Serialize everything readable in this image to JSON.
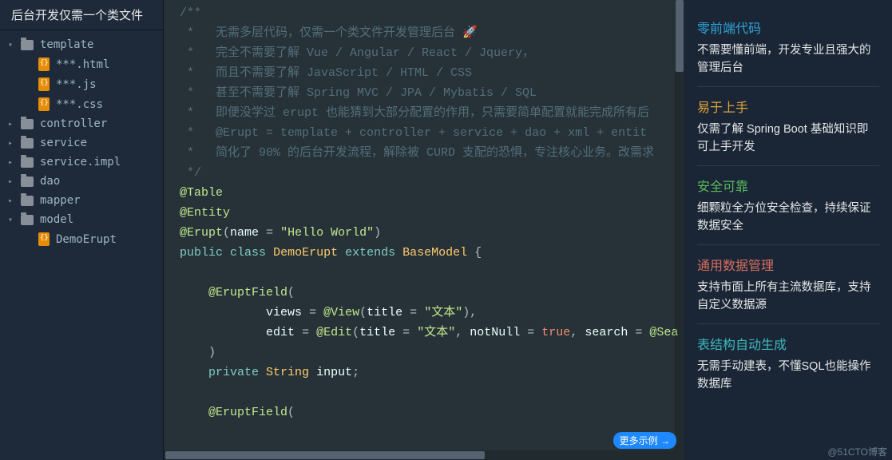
{
  "sidebar": {
    "title": "后台开发仅需一个类文件",
    "items": [
      {
        "label": "template",
        "type": "folder",
        "expand": "down"
      },
      {
        "label": "***.html",
        "type": "file"
      },
      {
        "label": "***.js",
        "type": "file"
      },
      {
        "label": "***.css",
        "type": "file"
      },
      {
        "label": "controller",
        "type": "folder",
        "expand": "right"
      },
      {
        "label": "service",
        "type": "folder",
        "expand": "right"
      },
      {
        "label": "service.impl",
        "type": "folder",
        "expand": "right"
      },
      {
        "label": "dao",
        "type": "folder",
        "expand": "right"
      },
      {
        "label": "mapper",
        "type": "folder",
        "expand": "right"
      },
      {
        "label": "model",
        "type": "folder",
        "expand": "down"
      },
      {
        "label": "DemoErupt",
        "type": "file"
      }
    ]
  },
  "code": {
    "c0": "/**",
    "c1": " *   无需多层代码，仅需一个类文件开发管理后台 🚀",
    "c2": " *   完全不需要了解 Vue / Angular / React / Jquery，",
    "c3": " *   而且不需要了解 JavaScript / HTML / CSS",
    "c4": " *   甚至不需要了解 Spring MVC / JPA / Mybatis / SQL",
    "c5": " *   即便没学过 erupt 也能猜到大部分配置的作用，只需要简单配置就能完成所有后",
    "c6": " *   @Erupt = template + controller + service + dao + xml + entit",
    "c7": " *   简化了 90% 的后台开发流程，解除被 CURD 支配的恐惧，专注核心业务。改需求",
    "c8": " */",
    "a_table": "@Table",
    "a_entity": "@Entity",
    "a_erupt": "@Erupt",
    "name_key": "name",
    "name_val": "\"Hello World\"",
    "kw_public": "public",
    "kw_class": "class",
    "cls_name": "DemoErupt",
    "kw_extends": "extends",
    "cls_base": "BaseModel",
    "a_field": "@EruptField",
    "views_key": "views",
    "a_view": "@View",
    "title_key": "title",
    "title_val": "\"文本\"",
    "edit_key": "edit",
    "a_edit": "@Edit",
    "notnull_key": "notNull",
    "true_val": "true",
    "search_key": "search",
    "a_sea": "@Sea",
    "kw_private": "private",
    "cls_string": "String",
    "fld_input": "input"
  },
  "editor": {
    "badge": "更多示例 →"
  },
  "features": [
    {
      "title": "零前端代码",
      "color": "blue",
      "desc": "不需要懂前端，开发专业且强大的管理后台"
    },
    {
      "title": "易于上手",
      "color": "orange",
      "desc": "仅需了解 Spring Boot 基础知识即可上手开发"
    },
    {
      "title": "安全可靠",
      "color": "green",
      "desc": "细颗粒全方位安全检查，持续保证数据安全"
    },
    {
      "title": "通用数据管理",
      "color": "red",
      "desc": "支持市面上所有主流数据库，支持自定义数据源"
    },
    {
      "title": "表结构自动生成",
      "color": "teal",
      "desc": "无需手动建表，不懂SQL也能操作数据库"
    }
  ],
  "watermark": "@51CTO博客"
}
